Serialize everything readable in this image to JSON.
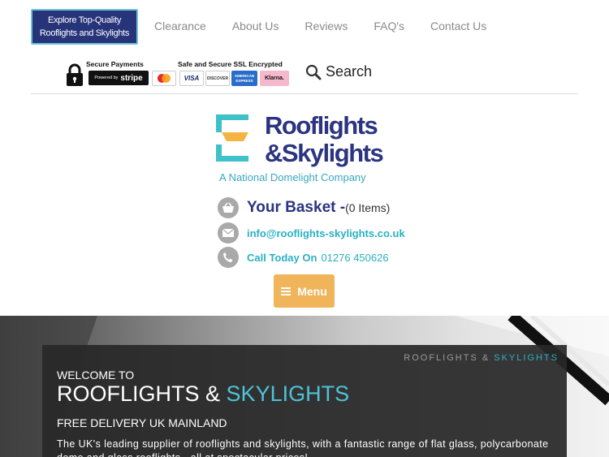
{
  "header": {
    "explore_line1": "Explore Top-Quality",
    "explore_line2": "Rooflights and Skylights",
    "nav": [
      "Clearance",
      "About Us",
      "Reviews",
      "FAQ's",
      "Contact Us"
    ]
  },
  "trust": {
    "secure_payments": "Secure Payments",
    "stripe_powered": "Powered by",
    "stripe_brand": "stripe",
    "ssl": "Safe and Secure SSL Encrypted",
    "cards": [
      "VISA",
      "DISCOVER",
      "AMERICAN EXPRESS",
      "Klarna."
    ]
  },
  "search": {
    "label": "Search"
  },
  "logo": {
    "line1": "Rooflights",
    "line2": "&Skylights",
    "tagline": "A National Domelight Company"
  },
  "basket": {
    "title": "Your Basket -",
    "count": "(0 Items)"
  },
  "contact": {
    "email": "info@rooflights-skylights.co.uk",
    "call_label": "Call Today On",
    "phone": "01276 450626"
  },
  "menu": {
    "label": "Menu"
  },
  "hero": {
    "brand_part1": "ROOFLIGHTS &",
    "brand_part2": "SKYLIGHTS",
    "welcome": "WELCOME TO",
    "title_part1": "ROOFLIGHTS &",
    "title_part2": "SKYLIGHTS",
    "delivery": "FREE DELIVERY UK MAINLAND",
    "description": "The UK's leading supplier of rooflights and skylights, with a fantastic range of flat glass, polycarbonate dome and glass rooflights - all at spectacular prices!"
  },
  "colors": {
    "navy": "#2b3480",
    "teal": "#2ab0c4",
    "orange": "#f0b45b",
    "logo_teal": "#3ec1c9",
    "logo_yellow": "#f3b443"
  }
}
